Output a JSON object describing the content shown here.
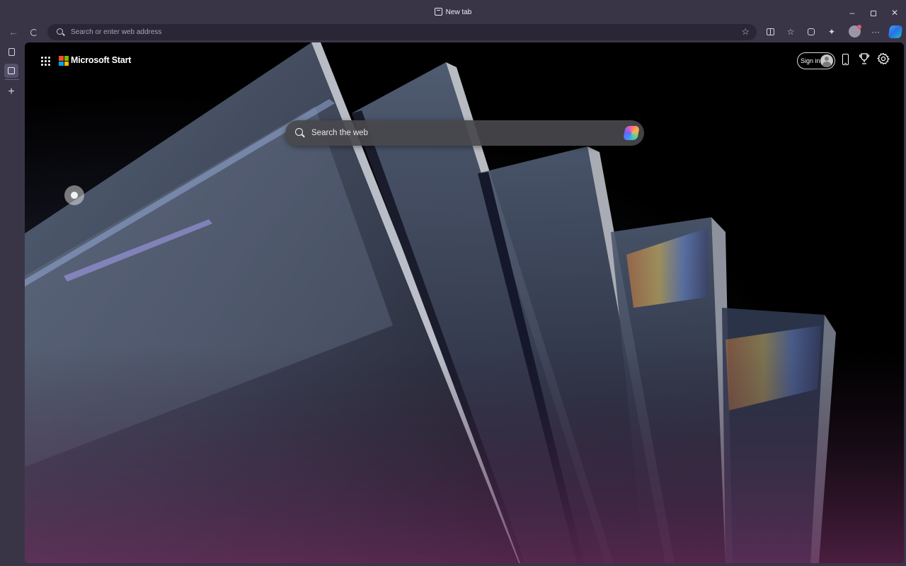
{
  "window": {
    "tab_title": "New tab",
    "controls": {
      "minimize": "–",
      "restore": "▫",
      "close": "✕"
    }
  },
  "toolbar": {
    "back": "←",
    "refresh": "C",
    "address_placeholder": "Search or enter web address",
    "favorite_star": "☆",
    "more": "···",
    "icons": [
      "split-screen-icon",
      "favorites-icon",
      "collections-icon",
      "extensions-icon",
      "profile-icon",
      "more-icon",
      "copilot-icon"
    ]
  },
  "sidebar": {
    "tab_actions_icon": "tab-actions-icon",
    "active_tab_icon": "new-tab-icon",
    "new_tab": "+"
  },
  "page": {
    "brand": "Microsoft Start",
    "logo_colors": [
      "#f25022",
      "#7fba00",
      "#00a4ef",
      "#ffb900"
    ],
    "sign_in": "Sign in",
    "search_placeholder": "Search the web",
    "trophy": "🏆",
    "settings": "⚙"
  }
}
